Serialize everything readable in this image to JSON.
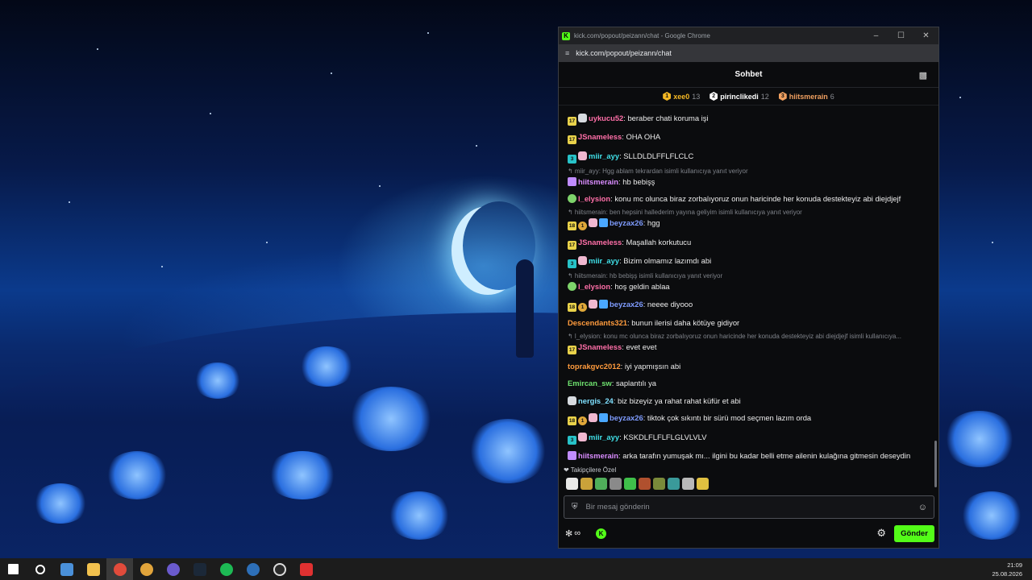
{
  "window": {
    "title": "kick.com/popout/peizann/chat - Google Chrome",
    "url": "kick.com/popout/peizann/chat"
  },
  "chat": {
    "header_title": "Sohbet",
    "leaderboard": [
      {
        "rank": "1",
        "name": "xee0",
        "count": "13",
        "color": "#f5b824"
      },
      {
        "rank": "2",
        "name": "pirinclikedi",
        "count": "12",
        "color": "#ffffff"
      },
      {
        "rank": "3",
        "name": "hiitsmerain",
        "count": "6",
        "color": "#f0a060"
      }
    ]
  },
  "messages": [
    {
      "badges": [
        [
          "b-sub",
          "17"
        ],
        [
          "b-avatar",
          ""
        ]
      ],
      "user": "uykucu52",
      "color": "#ff6fa8",
      "text": "beraber chati koruma işi"
    },
    {
      "badges": [
        [
          "b-sub",
          "17"
        ]
      ],
      "user": "JSnameless",
      "color": "#ff6fa8",
      "text": "OHA OHA"
    },
    {
      "badges": [
        [
          "b-teal",
          "3"
        ],
        [
          "b-pink",
          ""
        ]
      ],
      "user": "miir_ayy",
      "color": "#40e0e8",
      "text": "SLLDLDLFFLFLCLC"
    },
    {
      "reply": "miir_ayy: Hgg ablam tekrardan isimli kullanıcıya yanıt veriyor",
      "badges": [
        [
          "b-purple",
          ""
        ]
      ],
      "user": "hiitsmerain",
      "color": "#d98cff",
      "text": "hb bebişş"
    },
    {
      "badges": [
        [
          "b-green",
          ""
        ]
      ],
      "user": "l_elysion",
      "color": "#ff6fa8",
      "text": "konu mc olunca biraz zorbalıyoruz onun haricinde her konuda destekteyiz abi diejdjejf"
    },
    {
      "reply": "hiitsmerain: ben hepsini hallederim yayına geliyim isimli kullanıcıya yanıt veriyor",
      "badges": [
        [
          "b-sub",
          "18"
        ],
        [
          "b-og",
          "1"
        ],
        [
          "b-pink",
          ""
        ],
        [
          "b-vip",
          ""
        ]
      ],
      "user": "beyzax26",
      "color": "#7f9cff",
      "text": "hgg"
    },
    {
      "badges": [
        [
          "b-sub",
          "17"
        ]
      ],
      "user": "JSnameless",
      "color": "#ff6fa8",
      "text": "Maşallah korkutucu"
    },
    {
      "badges": [
        [
          "b-teal",
          "3"
        ],
        [
          "b-pink",
          ""
        ]
      ],
      "user": "miir_ayy",
      "color": "#40e0e8",
      "text": "Bizim olmamız lazımdı abi"
    },
    {
      "reply": "hiitsmerain: hb bebişş isimli kullanıcıya yanıt veriyor",
      "badges": [
        [
          "b-green",
          ""
        ]
      ],
      "user": "l_elysion",
      "color": "#ff6fa8",
      "text": "hoş geldin ablaa"
    },
    {
      "badges": [
        [
          "b-sub",
          "18"
        ],
        [
          "b-og",
          "1"
        ],
        [
          "b-pink",
          ""
        ],
        [
          "b-vip",
          ""
        ]
      ],
      "user": "beyzax26",
      "color": "#7f9cff",
      "text": "neeee diyooo"
    },
    {
      "badges": [],
      "user": "Descendants321",
      "color": "#ff9b3d",
      "text": "bunun ilerisi daha kötüye gidiyor"
    },
    {
      "reply": "l_elysion: konu mc olunca biraz zorbalıyoruz onun haricinde her konuda destekteyiz abi diejdjejf isimli kullanıcıya...",
      "badges": [
        [
          "b-sub",
          "17"
        ]
      ],
      "user": "JSnameless",
      "color": "#ff6fa8",
      "text": "evet evet"
    },
    {
      "badges": [],
      "user": "toprakgvc2012",
      "color": "#ff9b3d",
      "text": "iyi yapmışsın abi"
    },
    {
      "badges": [],
      "user": "Emircan_sw",
      "color": "#6fe36f",
      "text": "saplantılı ya"
    },
    {
      "badges": [
        [
          "b-avatar",
          ""
        ]
      ],
      "user": "nergis_24",
      "color": "#7fe0ff",
      "text": "biz bizeyiz ya rahat rahat küfür et abi"
    },
    {
      "badges": [
        [
          "b-sub",
          "18"
        ],
        [
          "b-og",
          "1"
        ],
        [
          "b-pink",
          ""
        ],
        [
          "b-vip",
          ""
        ]
      ],
      "user": "beyzax26",
      "color": "#7f9cff",
      "text": "tiktok çok sıkıntı bir sürü mod seçmen lazım orda"
    },
    {
      "badges": [
        [
          "b-teal",
          "3"
        ],
        [
          "b-pink",
          ""
        ]
      ],
      "user": "miir_ayy",
      "color": "#40e0e8",
      "text": "KSKDLFLFLFLGLVLVLV"
    },
    {
      "badges": [
        [
          "b-purple",
          ""
        ]
      ],
      "user": "hiitsmerain",
      "color": "#d98cff",
      "text": "arka tarafın yumuşak mı... ilgini bu kadar belli etme ailenin kulağına gitmesin deseydin"
    }
  ],
  "emotes": {
    "label": "Takipçilere Özel",
    "items": [
      "#e8e8e8",
      "#c9a23a",
      "#4fae5a",
      "#8a8a8a",
      "#3fc04a",
      "#b0502e",
      "#7a8a3a",
      "#3a9a9a",
      "#b8b8b8",
      "#e0c040"
    ]
  },
  "composer": {
    "placeholder": "Bir mesaj gönderin",
    "send_label": "Gönder",
    "points_label": "∞"
  },
  "taskbar": {
    "time": "21:09",
    "date": "25.08.2026"
  }
}
